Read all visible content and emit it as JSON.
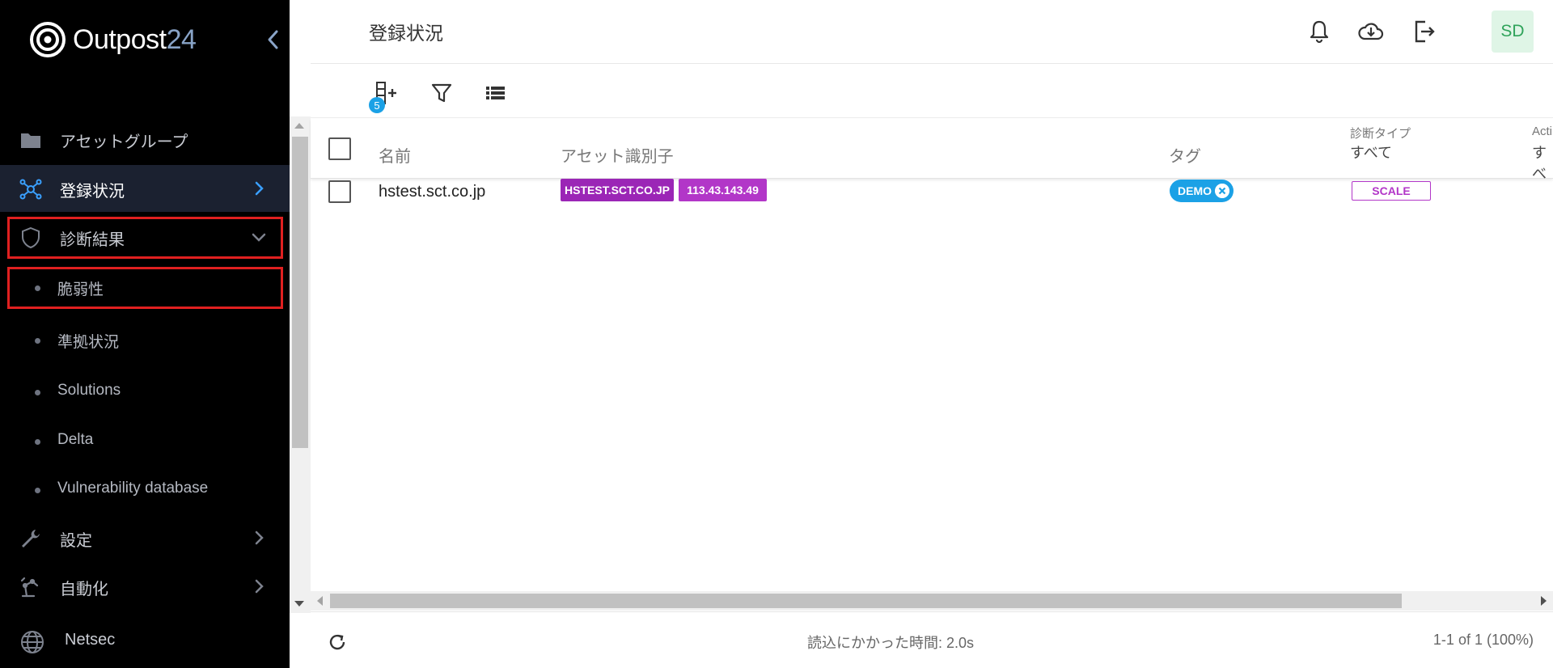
{
  "app": {
    "logo_name": "Outpost",
    "logo_number": "24"
  },
  "colors": {
    "sidebar_bg": "#000000",
    "active_item_bg": "#1b2130",
    "highlight": "#e02020",
    "accent_blue": "#1ba1e6",
    "chip_purple": "#9b26b6",
    "chip_magenta": "#b236c8",
    "avatar_bg": "#dff5e6",
    "avatar_text": "#2fa35a"
  },
  "sidebar": {
    "items": [
      {
        "label": "アセットグループ",
        "icon": "folder-icon"
      },
      {
        "label": "登録状況",
        "icon": "network-icon",
        "active": true
      },
      {
        "label": "診断結果",
        "icon": "shield-icon",
        "expanded": true
      },
      {
        "label": "設定",
        "icon": "wrench-icon"
      },
      {
        "label": "自動化",
        "icon": "automation-icon"
      },
      {
        "label": "Netsec",
        "icon": "globe-icon"
      }
    ],
    "subitems": [
      {
        "label": "脆弱性"
      },
      {
        "label": "準拠状況"
      },
      {
        "label": "Solutions"
      },
      {
        "label": "Delta"
      },
      {
        "label": "Vulnerability database"
      }
    ]
  },
  "header": {
    "title": "登録状況",
    "avatar": "SD"
  },
  "toolbar": {
    "badge_count": "5"
  },
  "table": {
    "columns": {
      "name": "名前",
      "asset_id": "アセット識別子",
      "tags": "タグ",
      "scan_type_label": "診断タイプ",
      "scan_type_filter": "すべて",
      "actions_label": "Acti",
      "actions_filter": "すべ"
    },
    "rows": [
      {
        "name": "hstest.sct.co.jp",
        "identifiers": [
          "HSTEST.SCT.CO.JP",
          "113.43.143.49"
        ],
        "tag": "DEMO",
        "scan_type": "SCALE"
      }
    ]
  },
  "footer": {
    "load_time": "読込にかかった時間: 2.0s",
    "pagination": "1-1 of 1 (100%)"
  }
}
